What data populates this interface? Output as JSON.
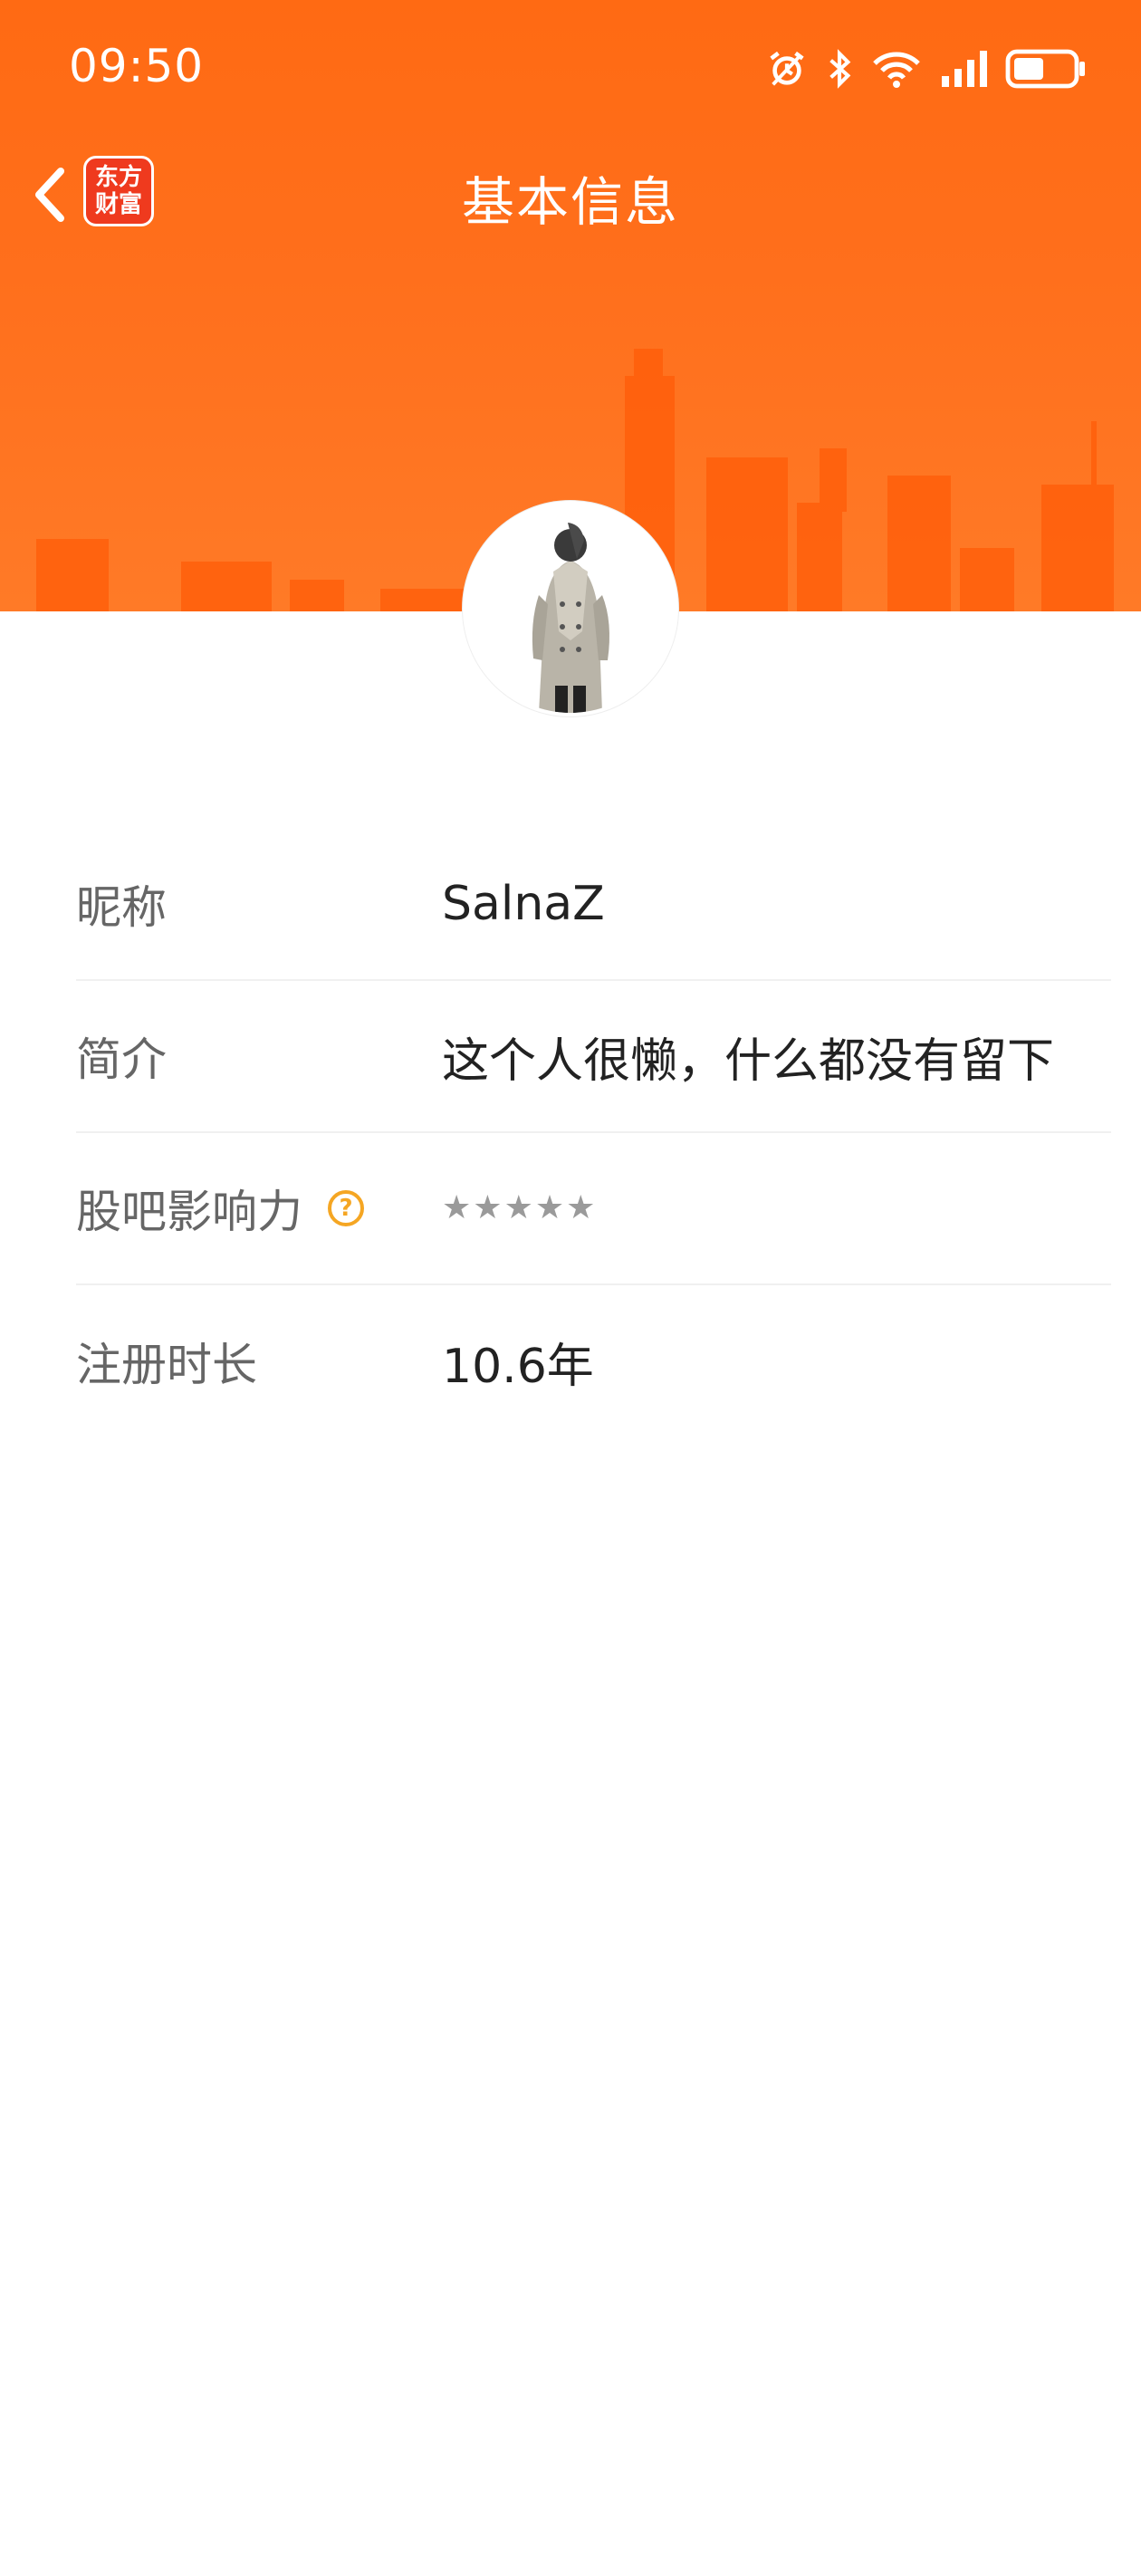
{
  "status_bar": {
    "time": "09:50",
    "icons": [
      "alarm-icon",
      "bluetooth-icon",
      "wifi-icon",
      "signal-icon",
      "battery-icon"
    ]
  },
  "nav": {
    "back_icon": "chevron-left-icon",
    "app_logo_line1": "东方",
    "app_logo_line2": "财富",
    "title": "基本信息"
  },
  "profile": {
    "avatar": "avatar-image"
  },
  "info": {
    "nickname": {
      "label": "昵称",
      "value": "SalnaZ"
    },
    "bio": {
      "label": "简介",
      "value": "这个人很懒，什么都没有留下"
    },
    "influence": {
      "label": "股吧影响力",
      "help_glyph": "?",
      "stars_total": 5,
      "stars_filled": 0
    },
    "registered": {
      "label": "注册时长",
      "value": "10.6年"
    }
  },
  "colors": {
    "header": "#ff6a13",
    "help_icon": "#f5a623",
    "label": "#666666",
    "value": "#222222",
    "logo": "#ef3a1e"
  }
}
